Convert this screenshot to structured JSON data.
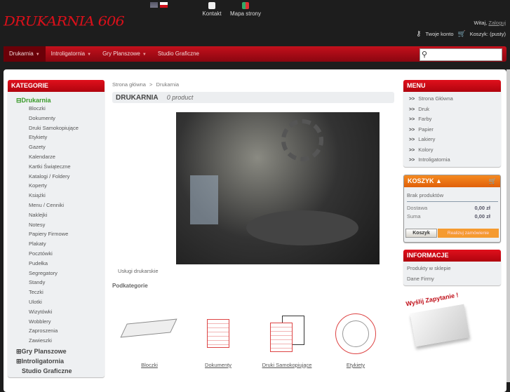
{
  "header": {
    "logo": "DRUKARNIA 606",
    "contact": "Kontakt",
    "sitemap": "Mapa strony",
    "greeting": "Witaj,",
    "login": "Zaloguj",
    "account": "Twoje konto",
    "cart": "Koszyk: (pusty)"
  },
  "nav": {
    "items": [
      "Drukarnia",
      "Introligatornia",
      "Gry Planszowe",
      "Studio Graficzne"
    ]
  },
  "categories": {
    "title": "KATEGORIE",
    "active": "Drukarnia",
    "sub": [
      "Bloczki",
      "Dokumenty",
      "Druki Samokopiujące",
      "Etykiety",
      "Gazety",
      "Kalendarze",
      "Kartki Świąteczne",
      "Katalogi / Foldery",
      "Koperty",
      "Książki",
      "Menu / Cenniki",
      "Naklejki",
      "Notesy",
      "Papiery Firmowe",
      "Plakaty",
      "Pocztówki",
      "Pudełka",
      "Segregatory",
      "Standy",
      "Teczki",
      "Ulotki",
      "Wizytówki",
      "Wobblery",
      "Zaproszenia",
      "Zawieszki"
    ],
    "others": [
      "Gry Planszowe",
      "Introligatornia",
      "Studio Graficzne"
    ]
  },
  "main": {
    "breadcrumb": [
      "Strona główna",
      ">",
      "Drukarnia"
    ],
    "title": "DRUKARNIA",
    "count": "0 product",
    "caption": "Usługi drukarskie",
    "subcats_title": "Podkategorie",
    "subcats": [
      "Bloczki",
      "Dokumenty",
      "Druki Samokopiujące",
      "Etykiety"
    ]
  },
  "menu": {
    "title": "MENU",
    "items": [
      "Strona Główna",
      "Druk",
      "Farby",
      "Papier",
      "Lakiery",
      "Kolory",
      "Introligatornia"
    ]
  },
  "cart": {
    "title": "KOSZYK",
    "empty": "Brak produktów",
    "shipping_label": "Dostawa",
    "shipping": "0,00 zł",
    "total_label": "Suma",
    "total": "0,00 zł",
    "cart_btn": "Koszyk",
    "order_btn": "Realizuj zamówienie"
  },
  "info": {
    "title": "INFORMACJE",
    "items": [
      "Produkty w sklepie",
      "Dane Firmy"
    ]
  },
  "inquiry": "Wyślij Zapytanie !"
}
